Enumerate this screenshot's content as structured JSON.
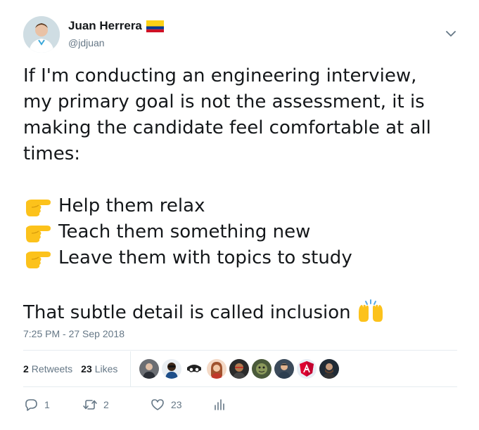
{
  "author": {
    "display_name": "Juan Herrera",
    "handle": "@jdjuan",
    "flag_icon": "colombia-flag-icon"
  },
  "body": {
    "lines": [
      "If I'm conducting an engineering interview,",
      "my primary goal is not the assessment, it is",
      "making the candidate feel comfortable at all",
      "times:"
    ],
    "points": [
      {
        "icon": "pointing-right-hand-icon",
        "text": "Help them relax"
      },
      {
        "icon": "pointing-right-hand-icon",
        "text": "Teach them something new"
      },
      {
        "icon": "pointing-right-hand-icon",
        "text": "Leave them with topics to study"
      }
    ],
    "closing": "That subtle detail is called inclusion",
    "closing_icon": "raising-hands-icon"
  },
  "timestamp": "7:25 PM - 27 Sep 2018",
  "stats": {
    "retweets_count": "2",
    "retweets_label": "Retweets",
    "likes_count": "23",
    "likes_label": "Likes",
    "liker_count_shown": 9
  },
  "actions": {
    "reply_count": "1",
    "retweet_count": "2",
    "like_count": "23"
  },
  "colors": {
    "text": "#14171a",
    "muted": "#657786",
    "divider": "#e6ecf0"
  }
}
